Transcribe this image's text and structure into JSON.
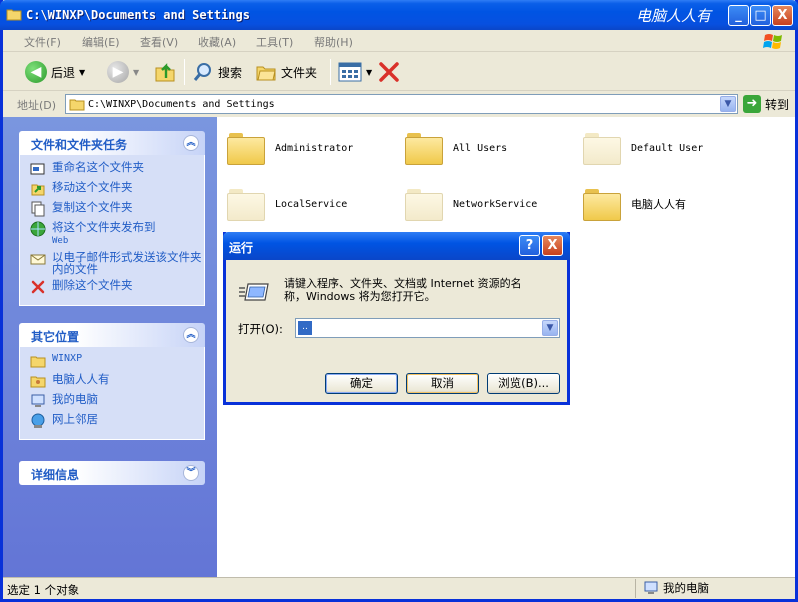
{
  "window": {
    "title": "C:\\WINXP\\Documents and Settings",
    "brand": "电脑人人有",
    "btn_min": "_",
    "btn_max": "□",
    "btn_close": "X"
  },
  "menu": [
    {
      "label": "文件(F)"
    },
    {
      "label": "编辑(E)"
    },
    {
      "label": "查看(V)"
    },
    {
      "label": "收藏(A)"
    },
    {
      "label": "工具(T)"
    },
    {
      "label": "帮助(H)"
    }
  ],
  "toolbar": {
    "back_label": "后退",
    "search_label": "搜索",
    "folders_label": "文件夹"
  },
  "address": {
    "label": "地址(D)",
    "value": "C:\\WINXP\\Documents and Settings",
    "go_label": "转到"
  },
  "tasks_panel": {
    "title": "文件和文件夹任务",
    "items": [
      {
        "label": "重命名这个文件夹"
      },
      {
        "label": "移动这个文件夹"
      },
      {
        "label": "复制这个文件夹"
      },
      {
        "label": "将这个文件夹发布到",
        "sub": "Web"
      },
      {
        "label": "以电子邮件形式发送该文件夹内的文件"
      },
      {
        "label": "删除这个文件夹"
      }
    ]
  },
  "places_panel": {
    "title": "其它位置",
    "items": [
      {
        "label": "WINXP"
      },
      {
        "label": "电脑人人有"
      },
      {
        "label": "我的电脑"
      },
      {
        "label": "网上邻居"
      }
    ]
  },
  "details_panel": {
    "title": "详细信息"
  },
  "folders": [
    {
      "name": "Administrator",
      "faded": false
    },
    {
      "name": "All Users",
      "faded": false
    },
    {
      "name": "Default User",
      "faded": true
    },
    {
      "name": "LocalService",
      "faded": true
    },
    {
      "name": "NetworkService",
      "faded": true
    },
    {
      "name": "电脑人人有",
      "faded": false
    }
  ],
  "run_dialog": {
    "title": "运行",
    "help": "?",
    "close": "X",
    "description_1": "请键入程序、文件夹、文档或 Internet 资源的名",
    "description_2": "称，Windows 将为您打开它。",
    "open_label": "打开(O):",
    "open_value": "..",
    "ok_label": "确定",
    "cancel_label": "取消",
    "browse_label": "浏览(B)..."
  },
  "status": {
    "selection": "选定 1 个对象",
    "location": "我的电脑"
  }
}
